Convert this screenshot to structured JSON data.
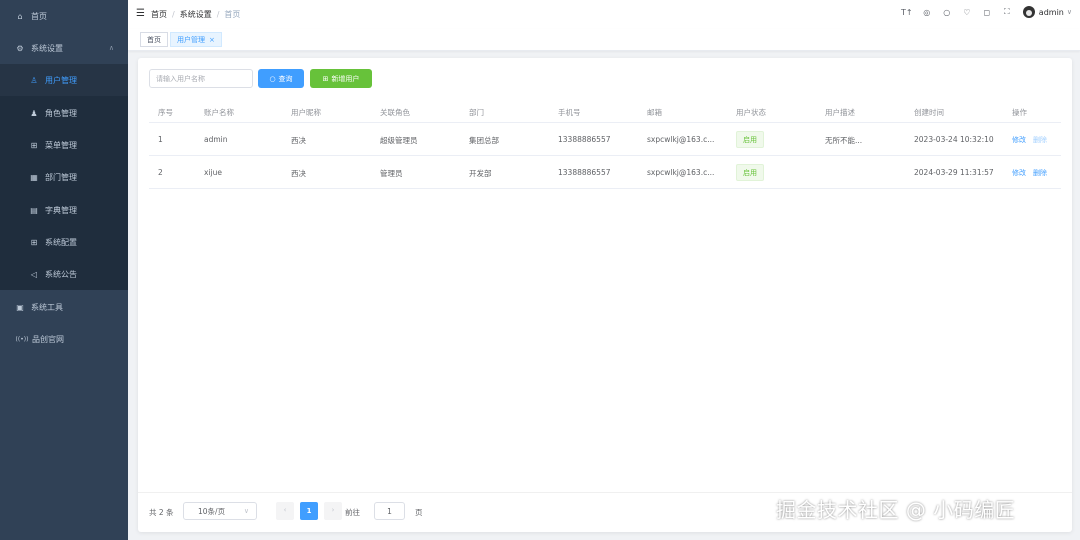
{
  "sidebar": {
    "home": {
      "icon": "⌂",
      "label": "首页"
    },
    "system": {
      "icon": "⚙",
      "label": "系统设置",
      "caret": "∧"
    },
    "sub_items": [
      {
        "icon": "♙",
        "label": "用户管理"
      },
      {
        "icon": "♟",
        "label": "角色管理"
      },
      {
        "icon": "⊞",
        "label": "菜单管理"
      },
      {
        "icon": "▦",
        "label": "部门管理"
      },
      {
        "icon": "▤",
        "label": "字典管理"
      },
      {
        "icon": "⊞",
        "label": "系统配置"
      },
      {
        "icon": "◁",
        "label": "系统公告"
      }
    ],
    "tools": {
      "icon": "▣",
      "label": "系统工具"
    },
    "website": {
      "icon": "((•))",
      "label": "品创官网"
    }
  },
  "navbar": {
    "hamburger": "☰",
    "breadcrumb": [
      "首页",
      "系统设置",
      "首页"
    ],
    "separator": "/",
    "icons": [
      "T↑",
      "◎",
      "○",
      "♡",
      "◻",
      "⛶"
    ],
    "user_name": "admin",
    "user_caret": "∨"
  },
  "tags": {
    "home": "首页",
    "active": "用户管理",
    "close": "×"
  },
  "toolbar": {
    "search_placeholder": "请输入用户名称",
    "query_icon": "○",
    "query_label": "查询",
    "add_icon": "⊞",
    "add_label": "新增用户"
  },
  "table": {
    "columns": [
      "序号",
      "账户名称",
      "用户昵称",
      "关联角色",
      "部门",
      "手机号",
      "邮箱",
      "用户状态",
      "用户描述",
      "创建时间",
      "操作"
    ],
    "rows": [
      {
        "index": "1",
        "account": "admin",
        "nickname": "西决",
        "role": "超级管理员",
        "dept": "集团总部",
        "phone": "13388886557",
        "email": "sxpcwlkj@163.c...",
        "status": "启用",
        "desc": "无所不能...",
        "created": "2023-03-24 10:32:10",
        "edit": "修改",
        "delete": "删除"
      },
      {
        "index": "2",
        "account": "xijue",
        "nickname": "西决",
        "role": "管理员",
        "dept": "开发部",
        "phone": "13388886557",
        "email": "sxpcwlkj@163.c...",
        "status": "启用",
        "desc": "",
        "created": "2024-03-29 11:31:57",
        "edit": "修改",
        "delete": "删除"
      }
    ]
  },
  "pagination": {
    "total": "共 2 条",
    "page_size": "10条/页",
    "size_chevron": "∨",
    "prev": "‹",
    "current": "1",
    "next": "›",
    "goto_label": "前往",
    "jump_value": "1",
    "page_suffix": "页"
  },
  "watermark": "掘金技术社区 @ 小码编匠",
  "colors": {
    "primary": "#409eff",
    "success": "#67c23a",
    "sidebar": "#304156"
  }
}
